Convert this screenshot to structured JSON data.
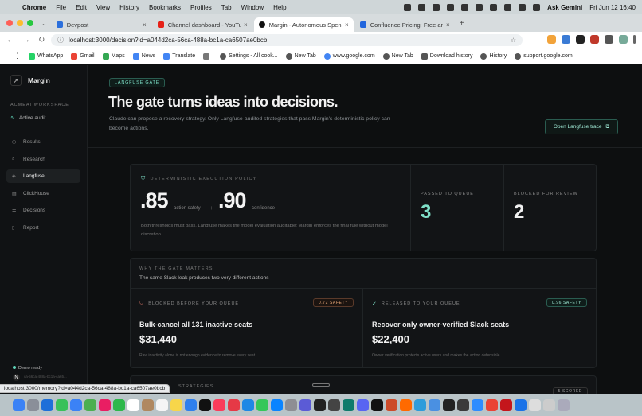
{
  "menubar": {
    "app": "Chrome",
    "items": [
      "File",
      "Edit",
      "View",
      "History",
      "Bookmarks",
      "Profiles",
      "Tab",
      "Window",
      "Help"
    ],
    "ask": "Ask Gemini",
    "clock": "Fri Jun 12  16:40"
  },
  "tabs": [
    {
      "title": "Devpost",
      "color": "#2b6fdc"
    },
    {
      "title": "Channel dashboard - YouTube",
      "color": "#e62117"
    },
    {
      "title": "Margin - Autonomous Spend",
      "color": "#111111"
    },
    {
      "title": "Confluence Pricing: Free and",
      "color": "#2266dd"
    }
  ],
  "address": {
    "url": "localhost:3000/decision?id=a044d2ca-56ca-488a-bc1a-ca6507ae0bcb"
  },
  "bookmarks": [
    {
      "label": "WhatsApp",
      "color": "#25d366"
    },
    {
      "label": "Gmail",
      "color": "#ea4335"
    },
    {
      "label": "Maps",
      "color": "#34a853"
    },
    {
      "label": "News",
      "color": "#4285f4"
    },
    {
      "label": "Translate",
      "color": "#4285f4"
    },
    {
      "label": "",
      "color": "#777777"
    },
    {
      "label": "Settings - All cook...",
      "color": "#555555"
    },
    {
      "label": "New Tab",
      "color": "#555555"
    },
    {
      "label": "www.google.com",
      "color": "#4285f4"
    },
    {
      "label": "New Tab",
      "color": "#555555"
    },
    {
      "label": "Download history",
      "color": "#555555"
    },
    {
      "label": "History",
      "color": "#555555"
    },
    {
      "label": "support.google.com",
      "color": "#555555"
    }
  ],
  "sidebar": {
    "brand": "Margin",
    "workspace": "ACMEAI WORKSPACE",
    "audit": "Active audit",
    "items": [
      {
        "label": "Results",
        "icon": "clock-icon"
      },
      {
        "label": "Research",
        "icon": "search-icon"
      },
      {
        "label": "Langfuse",
        "icon": "langfuse-icon"
      },
      {
        "label": "ClickHouse",
        "icon": "database-icon"
      },
      {
        "label": "Decisions",
        "icon": "list-icon"
      },
      {
        "label": "Report",
        "icon": "document-icon"
      }
    ],
    "demo": "Demo ready",
    "demo_sub": "ca-56ca-488a-bc1a-ca65..."
  },
  "page": {
    "chip": "LANGFUSE GATE",
    "title": "The gate turns ideas into decisions.",
    "lede": "Claude can propose a recovery strategy. Only Langfuse-audited strategies that pass Margin's deterministic policy can become actions.",
    "trace_button": "Open Langfuse trace"
  },
  "policy": {
    "label": "DETERMINISTIC EXECUTION POLICY",
    "safety_value": ".85",
    "safety_label": "action safety",
    "plus": "+",
    "confidence_value": ".90",
    "confidence_label": "confidence",
    "note": "Both thresholds must pass. Langfuse makes the model evaluation auditable; Margin enforces the final rule without model discretion.",
    "passed_label": "PASSED TO QUEUE",
    "passed_value": "3",
    "blocked_label": "BLOCKED FOR REVIEW",
    "blocked_value": "2",
    "passed_color": "#7fe0c8"
  },
  "why": {
    "label": "WHY THE GATE MATTERS",
    "subtitle": "The same Slack leak produces two very different actions",
    "blocked": {
      "head": "BLOCKED BEFORE YOUR QUEUE",
      "badge": "0.72 SAFETY",
      "title": "Bulk-cancel all 131 inactive seats",
      "amount": "$31,440",
      "note": "Raw inactivity alone is not enough evidence to remove every seat."
    },
    "released": {
      "head": "RELEASED TO YOUR QUEUE",
      "badge": "0.96 SAFETY",
      "title": "Recover only owner-verified Slack seats",
      "amount": "$22,400",
      "note": "Owner verification protects active users and makes the action defensible."
    }
  },
  "bottom": {
    "label": "STRATEGIES",
    "badge": "5 SCORED"
  },
  "statusbar": "localhost:3000/memory?id=a044d2ca-56ca-488a-bc1a-ca6507ae0bcb"
}
